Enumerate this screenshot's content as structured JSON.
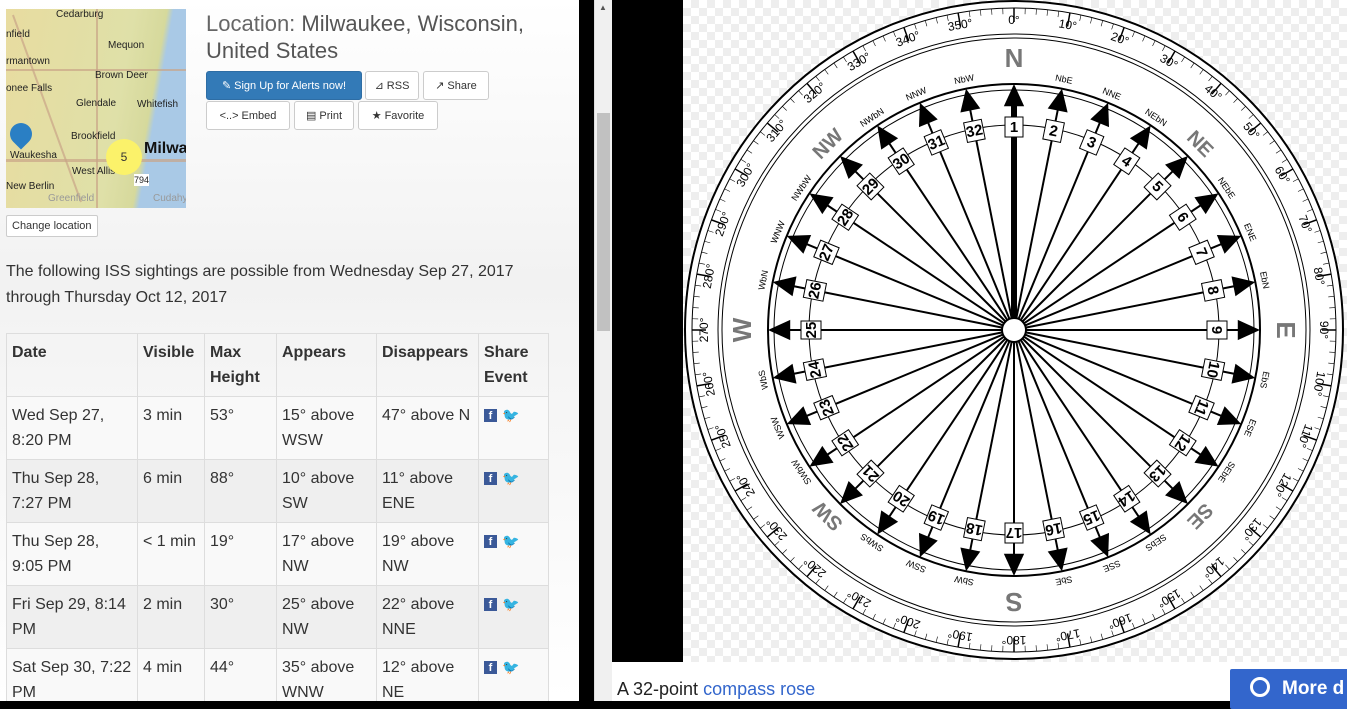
{
  "location": {
    "title_prefix": "Location:",
    "title": "Milwaukee, Wisconsin, United States"
  },
  "map": {
    "towns": [
      "Cedarburg",
      "nfield",
      "Mequon",
      "rmantown",
      "Brown Deer",
      "onee Falls",
      "Glendale",
      "Whitefish",
      "Brookfield",
      "Waukesha",
      "West Allis",
      "New Berlin",
      "Greenfield",
      "Cudahy",
      "Milwa",
      "794"
    ],
    "cluster_count": "5"
  },
  "buttons": {
    "alerts": "Sign Up for Alerts now!",
    "rss": "RSS",
    "share": "Share",
    "embed": "Embed",
    "print": "Print",
    "favorite": "Favorite",
    "change_location": "Change location"
  },
  "intro": "The following ISS sightings are possible from Wednesday Sep 27, 2017 through Thursday Oct 12, 2017",
  "table": {
    "headers": [
      "Date",
      "Visible",
      "Max Height",
      "Appears",
      "Disappears",
      "Share Event"
    ],
    "rows": [
      [
        "Wed Sep 27, 8:20 PM",
        "3 min",
        "53°",
        "15° above WSW",
        "47° above N"
      ],
      [
        "Thu Sep 28, 7:27 PM",
        "6 min",
        "88°",
        "10° above SW",
        "11° above ENE"
      ],
      [
        "Thu Sep 28, 9:05 PM",
        "< 1 min",
        "19°",
        "17° above NW",
        "19° above NW"
      ],
      [
        "Fri Sep 29, 8:14 PM",
        "2 min",
        "30°",
        "25° above NW",
        "22° above NNE"
      ],
      [
        "Sat Sep 30, 7:22 PM",
        "4 min",
        "44°",
        "35° above WNW",
        "12° above NE"
      ]
    ]
  },
  "compass": {
    "points": [
      "N",
      "NbE",
      "NNE",
      "NEbN",
      "NE",
      "NEbE",
      "ENE",
      "EbN",
      "E",
      "EbS",
      "ESE",
      "SEbE",
      "SE",
      "SEbS",
      "SSE",
      "SbE",
      "S",
      "SbW",
      "SSW",
      "SWbS",
      "SW",
      "SWbW",
      "WSW",
      "WbS",
      "W",
      "WbN",
      "WNW",
      "NWbW",
      "NW",
      "NWbN",
      "NNW",
      "NbW"
    ],
    "degrees": [
      "0°",
      "10°",
      "20°",
      "30°",
      "40°",
      "50°",
      "60°",
      "70°",
      "80°",
      "90°",
      "100°",
      "110°",
      "120°",
      "130°",
      "140°",
      "150°",
      "160°",
      "170°",
      "180°",
      "190°",
      "200°",
      "210°",
      "220°",
      "230°",
      "240°",
      "250°",
      "260°",
      "270°",
      "280°",
      "290°",
      "300°",
      "310°",
      "320°",
      "330°",
      "340°",
      "350°"
    ]
  },
  "caption": {
    "prefix": "A 32-point ",
    "link": "compass rose"
  },
  "more_button": "More d"
}
